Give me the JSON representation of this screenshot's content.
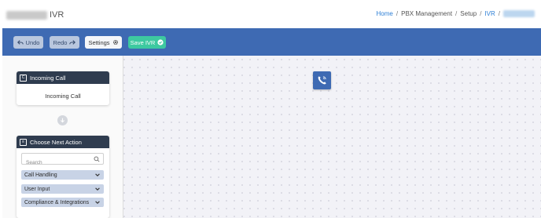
{
  "header": {
    "title_suffix": "IVR",
    "breadcrumb": {
      "home": "Home",
      "pbx": "PBX Management",
      "setup": "Setup",
      "ivr": "IVR",
      "separator": "/"
    }
  },
  "toolbar": {
    "undo_label": "Undo",
    "redo_label": "Redo",
    "settings_label": "Settings",
    "save_label": "Save IVR"
  },
  "incoming_card": {
    "title": "Incoming Call",
    "body": "Incoming Call"
  },
  "next_action": {
    "title": "Choose Next Action",
    "search_placeholder": "Search",
    "sections": [
      {
        "label": "Call Handling"
      },
      {
        "label": "User Input"
      },
      {
        "label": "Compliance & Integrations"
      }
    ]
  },
  "colors": {
    "toolbar": "#3e6ab3",
    "save": "#3dc9a0",
    "card_header": "#2f3c4f",
    "link": "#2f80d6"
  },
  "icons": {
    "undo": "undo-arrow-icon",
    "redo": "redo-arrow-icon",
    "settings": "gear-icon",
    "save": "check-circle-icon",
    "canvas_node": "phone-ringing-icon"
  }
}
